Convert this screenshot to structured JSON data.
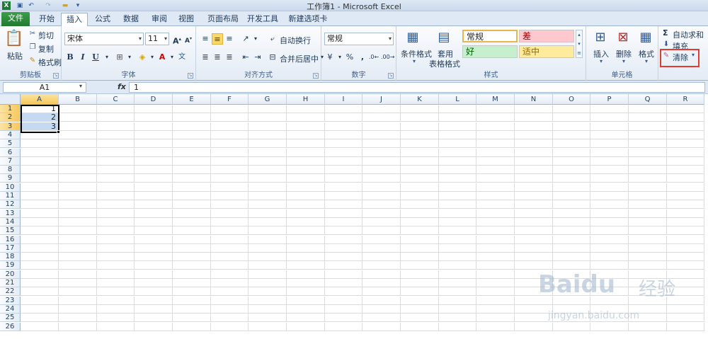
{
  "window": {
    "title": "工作簿1 - Microsoft Excel"
  },
  "tabs": [
    "文件",
    "开始",
    "插入",
    "公式",
    "数据",
    "审阅",
    "视图",
    "页面布局",
    "开发工具",
    "新建选项卡"
  ],
  "ribbon": {
    "clipboard": {
      "label": "剪贴板",
      "paste": "粘贴",
      "cut": "剪切",
      "copy": "复制",
      "format_painter": "格式刷"
    },
    "font": {
      "label": "字体",
      "font_name": "宋体",
      "font_size": "11",
      "bold": "B",
      "italic": "I",
      "underline": "U"
    },
    "alignment": {
      "label": "对齐方式",
      "wrap_text": "自动换行",
      "merge_center": "合并后居中"
    },
    "number": {
      "label": "数字",
      "format": "常规",
      "percent": "%",
      "comma": ","
    },
    "styles": {
      "label": "样式",
      "conditional_formatting": "条件格式",
      "format_as_table_1": "套用",
      "format_as_table_2": "表格格式",
      "normal": "常规",
      "bad": "差",
      "good": "好",
      "neutral": "适中"
    },
    "cells": {
      "label": "单元格",
      "insert": "插入",
      "delete": "删除",
      "format": "格式"
    },
    "editing": {
      "autosum": "自动求和",
      "fill": "填充",
      "clear": "清除",
      "sigma": "Σ"
    }
  },
  "formula_bar": {
    "name_box": "A1",
    "fx": "fx",
    "value": "1"
  },
  "grid": {
    "columns": [
      "A",
      "B",
      "C",
      "D",
      "E",
      "F",
      "G",
      "H",
      "I",
      "J",
      "K",
      "L",
      "M",
      "N",
      "O",
      "P",
      "Q",
      "R"
    ],
    "rows": [
      "1",
      "2",
      "3",
      "4",
      "5",
      "6",
      "7",
      "8",
      "9",
      "10",
      "11",
      "12",
      "13",
      "14",
      "15",
      "16",
      "17",
      "18",
      "19",
      "20",
      "21",
      "22",
      "23",
      "24",
      "25",
      "26"
    ],
    "cells": {
      "A1": "1",
      "A2": "2",
      "A3": "3"
    }
  },
  "watermark": {
    "brand": "Baidu",
    "text": "经验",
    "url": "jingyan.baidu.com"
  },
  "colors": {
    "file_tab": "#237a30",
    "highlight": "#e03c31",
    "bad_bg": "#ffc7ce",
    "good_bg": "#c6efce",
    "neutral_bg": "#ffeb9c"
  }
}
